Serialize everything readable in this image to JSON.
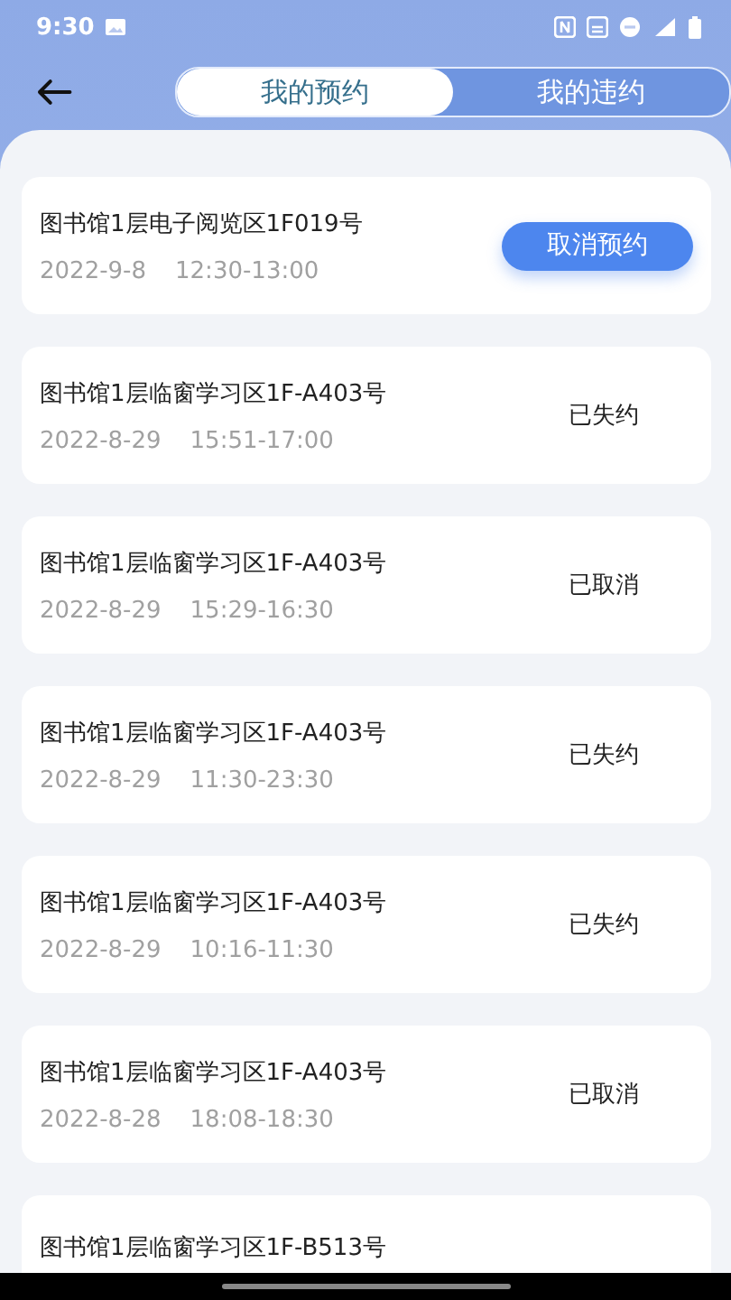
{
  "status_bar": {
    "time": "9:30"
  },
  "tabs": [
    {
      "label": "我的预约",
      "selected": true
    },
    {
      "label": "我的违约",
      "selected": false
    }
  ],
  "reservations": [
    {
      "place": "图书馆1层电子阅览区1F019号",
      "date": "2022-9-8",
      "time": "12:30-13:00",
      "kind": "action",
      "action": "取消预约"
    },
    {
      "place": "图书馆1层临窗学习区1F-A403号",
      "date": "2022-8-29",
      "time": "15:51-17:00",
      "kind": "status",
      "status": "已失约"
    },
    {
      "place": "图书馆1层临窗学习区1F-A403号",
      "date": "2022-8-29",
      "time": "15:29-16:30",
      "kind": "status",
      "status": "已取消"
    },
    {
      "place": "图书馆1层临窗学习区1F-A403号",
      "date": "2022-8-29",
      "time": "11:30-23:30",
      "kind": "status",
      "status": "已失约"
    },
    {
      "place": "图书馆1层临窗学习区1F-A403号",
      "date": "2022-8-29",
      "time": "10:16-11:30",
      "kind": "status",
      "status": "已失约"
    },
    {
      "place": "图书馆1层临窗学习区1F-A403号",
      "date": "2022-8-28",
      "time": "18:08-18:30",
      "kind": "status",
      "status": "已取消"
    },
    {
      "place": "图书馆1层临窗学习区1F-B513号",
      "kind": "partial"
    }
  ]
}
